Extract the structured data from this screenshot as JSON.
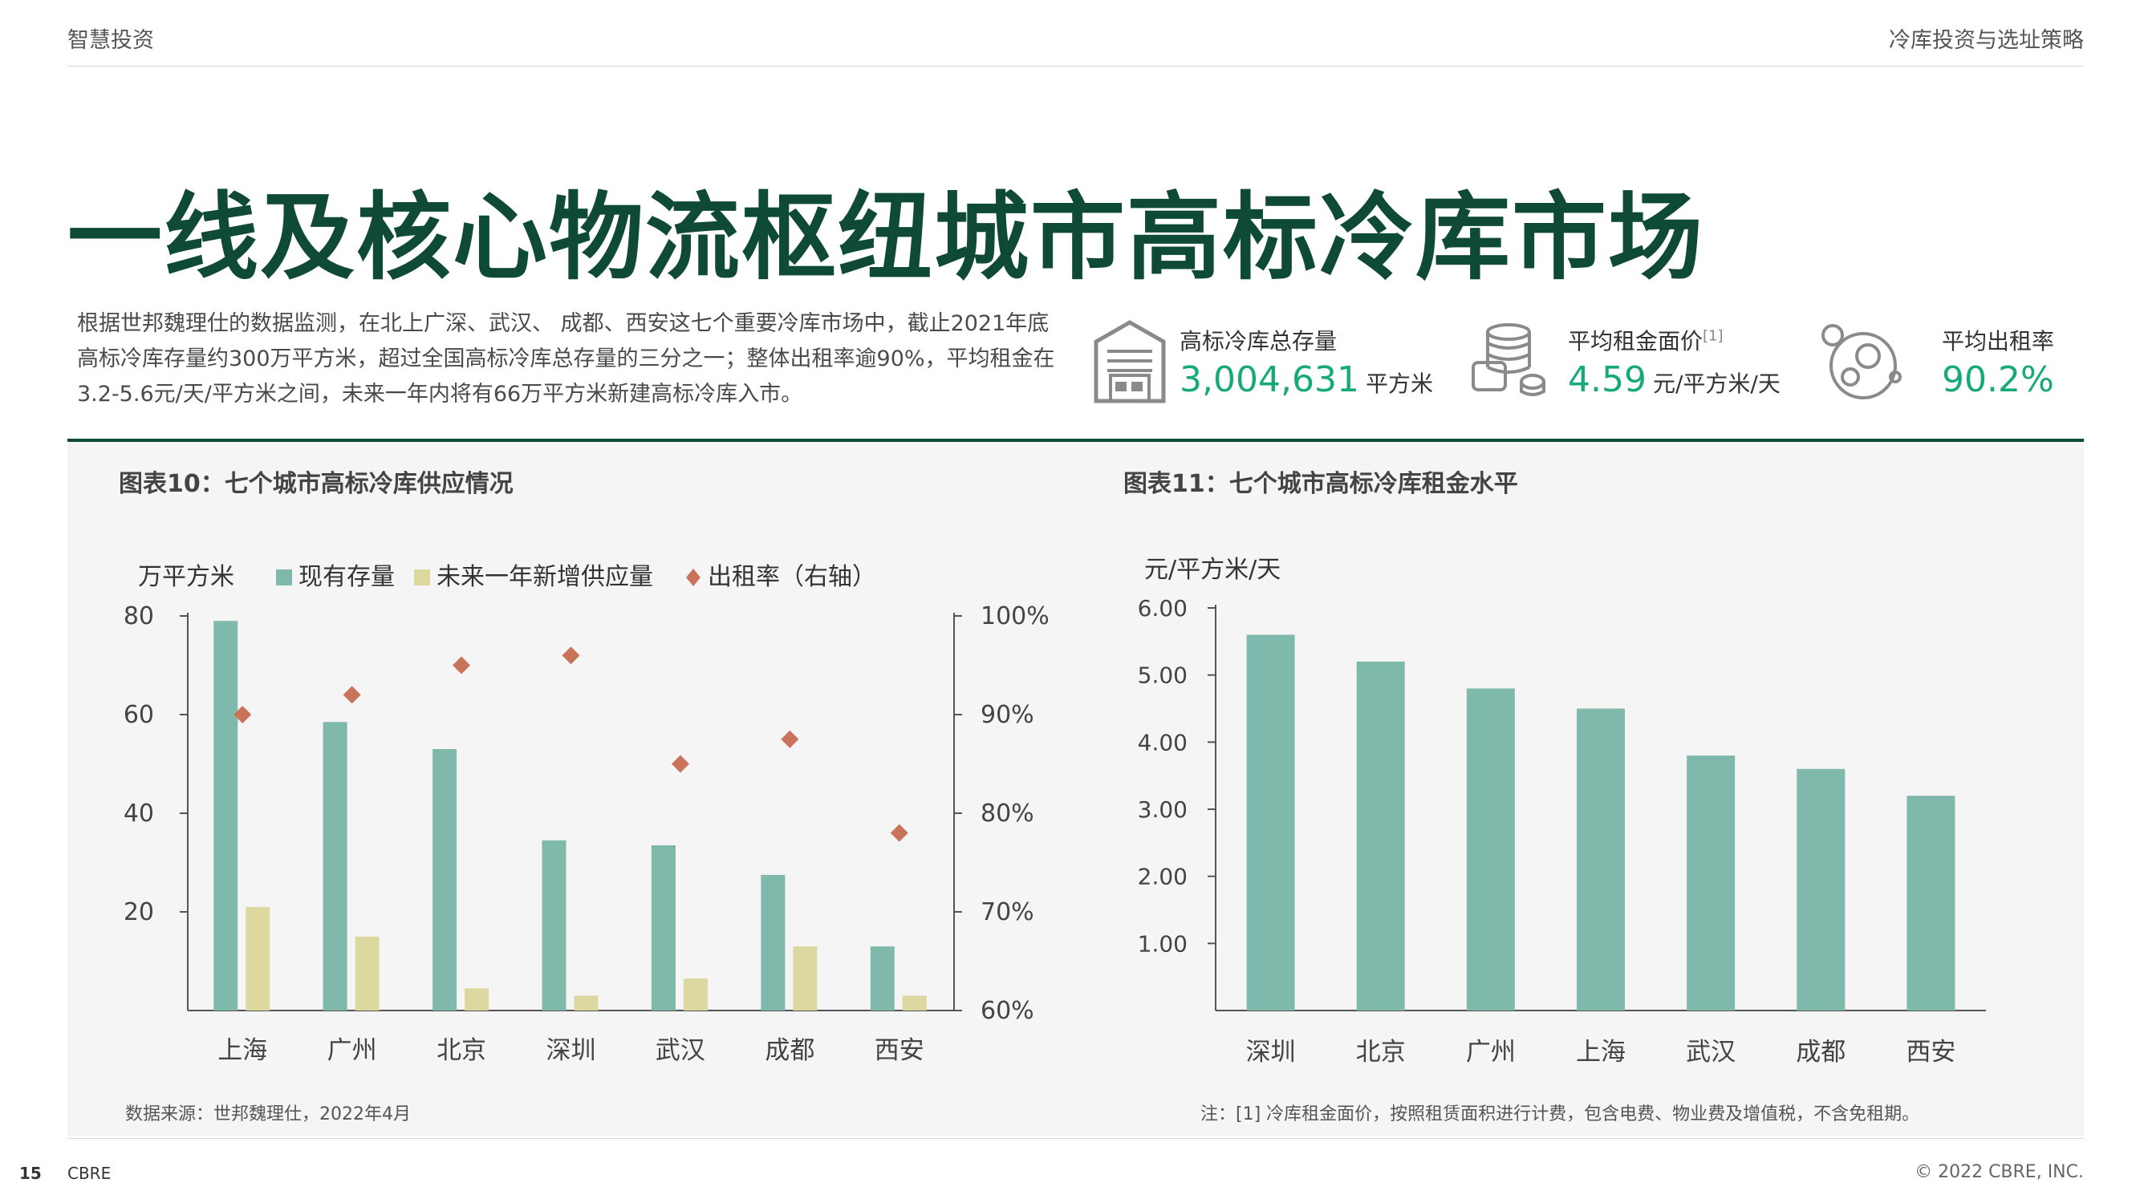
{
  "header": {
    "left": "智慧投资",
    "right": "冷库投资与选址策略"
  },
  "title": "一线及核心物流枢纽城市高标冷库市场",
  "intro": "根据世邦魏理仕的数据监测，在北上广深、武汉、 成都、西安这七个重要冷库市场中，截止2021年底高标冷库存量约300万平方米，超过全国高标冷库总存量的三分之一；整体出租率逾90%，平均租金在3.2-5.6元/天/平方米之间，未来一年内将有66万平方米新建高标冷库入市。",
  "kpis": [
    {
      "icon": "warehouse-icon",
      "label": "高标冷库总存量",
      "sup": "",
      "value": "3,004,631",
      "unit": "平方米"
    },
    {
      "icon": "coins-icon",
      "label": "平均租金面价",
      "sup": "[1]",
      "value": "4.59",
      "unit": "元/平方米/天"
    },
    {
      "icon": "bubbles-icon",
      "label": "平均出租率",
      "sup": "",
      "value": "90.2%",
      "unit": ""
    }
  ],
  "colors": {
    "title_green": "#0f4a37",
    "accent_green": "#18a97a",
    "bar_teal": "#7fb9ab",
    "bar_khaki": "#dcd8a0",
    "marker_red": "#c8735a"
  },
  "chart_data": [
    {
      "type": "bar",
      "title": "图表10：七个城市高标冷库供应情况",
      "ylabel": "万平方米",
      "y2label": "",
      "categories": [
        "上海",
        "广州",
        "北京",
        "深圳",
        "武汉",
        "成都",
        "西安"
      ],
      "ylim": [
        0,
        80
      ],
      "yticks": [
        "80",
        "60",
        "40",
        "20"
      ],
      "y2lim": [
        60,
        100
      ],
      "y2ticks": [
        "100%",
        "90%",
        "80%",
        "70%",
        "60%"
      ],
      "series": [
        {
          "name": "现有存量",
          "kind": "bar",
          "axis": "left",
          "values": [
            79,
            58.5,
            53,
            34.5,
            33.5,
            27.5,
            13
          ]
        },
        {
          "name": "未来一年新增供应量",
          "kind": "bar",
          "axis": "left",
          "values": [
            21,
            15,
            4.5,
            3,
            6.5,
            13,
            3
          ]
        },
        {
          "name": "出租率（右轴）",
          "kind": "marker",
          "axis": "right",
          "values": [
            90,
            92,
            95,
            96,
            85,
            87.5,
            78
          ]
        }
      ],
      "legend": "top",
      "grid": false,
      "source": "数据来源：世邦魏理仕，2022年4月"
    },
    {
      "type": "bar",
      "title": "图表11：七个城市高标冷库租金水平",
      "ylabel": "元/平方米/天",
      "categories": [
        "深圳",
        "北京",
        "广州",
        "上海",
        "武汉",
        "成都",
        "西安"
      ],
      "ylim": [
        0,
        6
      ],
      "yticks": [
        "6.00",
        "5.00",
        "4.00",
        "3.00",
        "2.00",
        "1.00"
      ],
      "values": [
        5.6,
        5.2,
        4.8,
        4.5,
        3.8,
        3.6,
        3.2
      ],
      "grid": false,
      "note": "注：[1] 冷库租金面价，按照租赁面积进行计费，包含电费、物业费及增值税，不含免租期。"
    }
  ],
  "footer": {
    "page": "15",
    "brand": "CBRE",
    "copyright": "© 2022 CBRE, INC."
  }
}
